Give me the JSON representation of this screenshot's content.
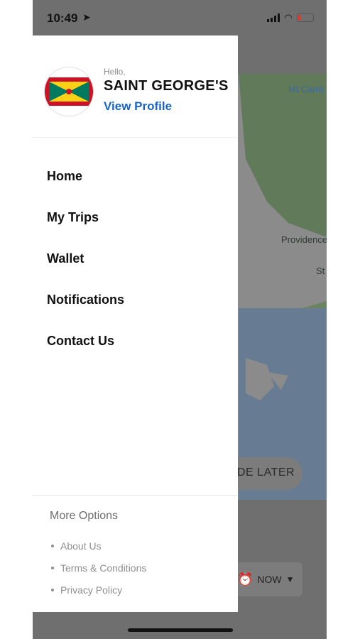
{
  "status_bar": {
    "time": "10:49"
  },
  "drawer": {
    "greeting": "Hello,",
    "user_name": "SAINT GEORGE'S",
    "view_profile": "View Profile",
    "menu": [
      "Home",
      "My Trips",
      "Wallet",
      "Notifications",
      "Contact Us"
    ],
    "more_options_title": "More Options",
    "more_options": [
      "About Us",
      "Terms & Conditions",
      "Privacy Policy"
    ]
  },
  "map": {
    "labels": [
      "Mt Carm",
      "Providence",
      "St"
    ]
  },
  "background_buttons": {
    "ride_later": "DE LATER",
    "now": "NOW"
  },
  "colors": {
    "accent": "#1a64c8",
    "overlay": "#6f6f6f",
    "flag_red": "#ce1126",
    "flag_yellow": "#fcd116",
    "flag_green": "#007a5e"
  }
}
